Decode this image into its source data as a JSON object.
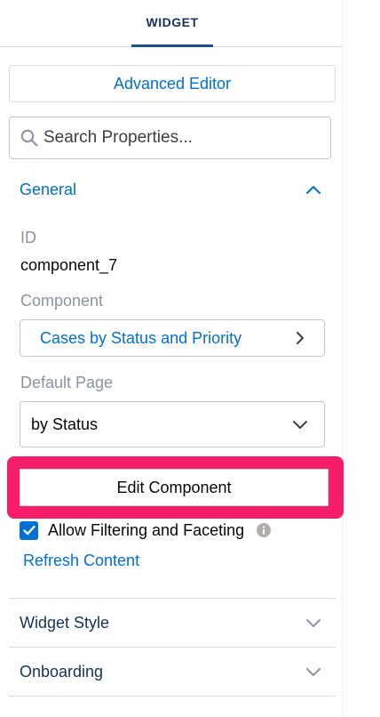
{
  "tabs": {
    "active_label": "WIDGET"
  },
  "advanced_editor": {
    "label": "Advanced Editor"
  },
  "search": {
    "placeholder": "Search Properties..."
  },
  "general": {
    "title": "General",
    "id_label": "ID",
    "id_value": "component_7",
    "component_label": "Component",
    "component_value": "Cases by Status and Priority",
    "default_page_label": "Default Page",
    "default_page_value": "by Status",
    "edit_button_label": "Edit Component",
    "allow_filtering_label": "Allow Filtering and Faceting",
    "allow_filtering_checked": true,
    "refresh_link_label": "Refresh Content"
  },
  "sections": [
    {
      "title": "Widget Style"
    },
    {
      "title": "Onboarding"
    }
  ],
  "colors": {
    "accent": "#0070d2",
    "highlight": "#f81d6b",
    "tab_underline": "#1b5297"
  },
  "icons": [
    "search-icon",
    "chevron-up-icon",
    "chevron-right-icon",
    "chevron-down-icon",
    "checkmark-icon",
    "info-icon"
  ]
}
